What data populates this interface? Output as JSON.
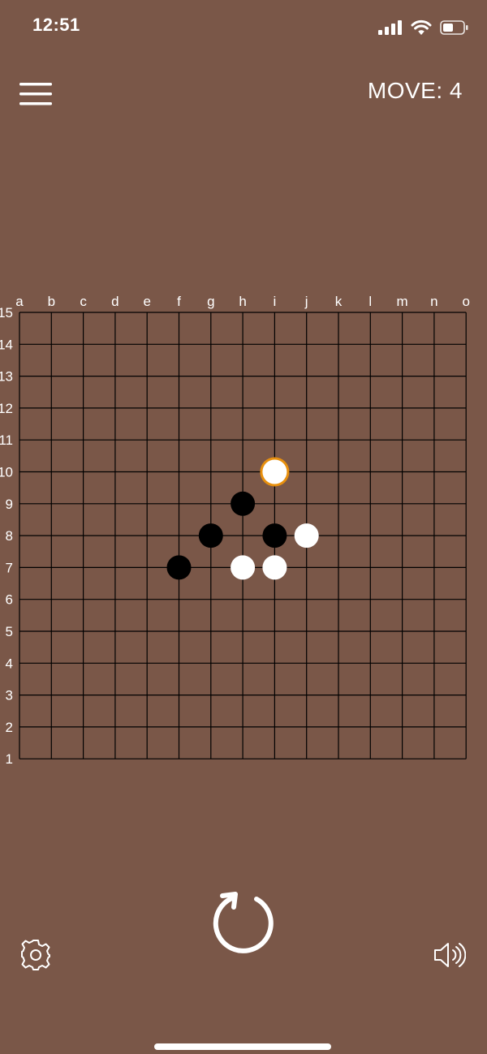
{
  "status_bar": {
    "time": "12:51",
    "icons": [
      "signal-icon",
      "wifi-icon",
      "battery-icon"
    ]
  },
  "header": {
    "menu_icon": "hamburger-menu-icon",
    "move_label": "MOVE: 4"
  },
  "board": {
    "size": 15,
    "columns": [
      "a",
      "b",
      "c",
      "d",
      "e",
      "f",
      "g",
      "h",
      "i",
      "j",
      "k",
      "l",
      "m",
      "n",
      "o"
    ],
    "rows": [
      "15",
      "14",
      "13",
      "12",
      "11",
      "10",
      "9",
      "8",
      "7",
      "6",
      "5",
      "4",
      "3",
      "2",
      "1"
    ],
    "stones": [
      {
        "col": "i",
        "row": 10,
        "color": "white",
        "last_move": true
      },
      {
        "col": "h",
        "row": 9,
        "color": "black"
      },
      {
        "col": "g",
        "row": 8,
        "color": "black"
      },
      {
        "col": "i",
        "row": 8,
        "color": "black"
      },
      {
        "col": "j",
        "row": 8,
        "color": "white"
      },
      {
        "col": "f",
        "row": 7,
        "color": "black"
      },
      {
        "col": "h",
        "row": 7,
        "color": "white"
      },
      {
        "col": "i",
        "row": 7,
        "color": "white"
      }
    ]
  },
  "colors": {
    "background": "#7a5748",
    "grid_line": "#000000",
    "black_stone": "#000000",
    "white_stone": "#ffffff",
    "last_move_ring": "#e8900e"
  },
  "footer": {
    "reset_icon": "restart-icon",
    "settings_icon": "gear-icon",
    "sound_icon": "speaker-icon"
  }
}
